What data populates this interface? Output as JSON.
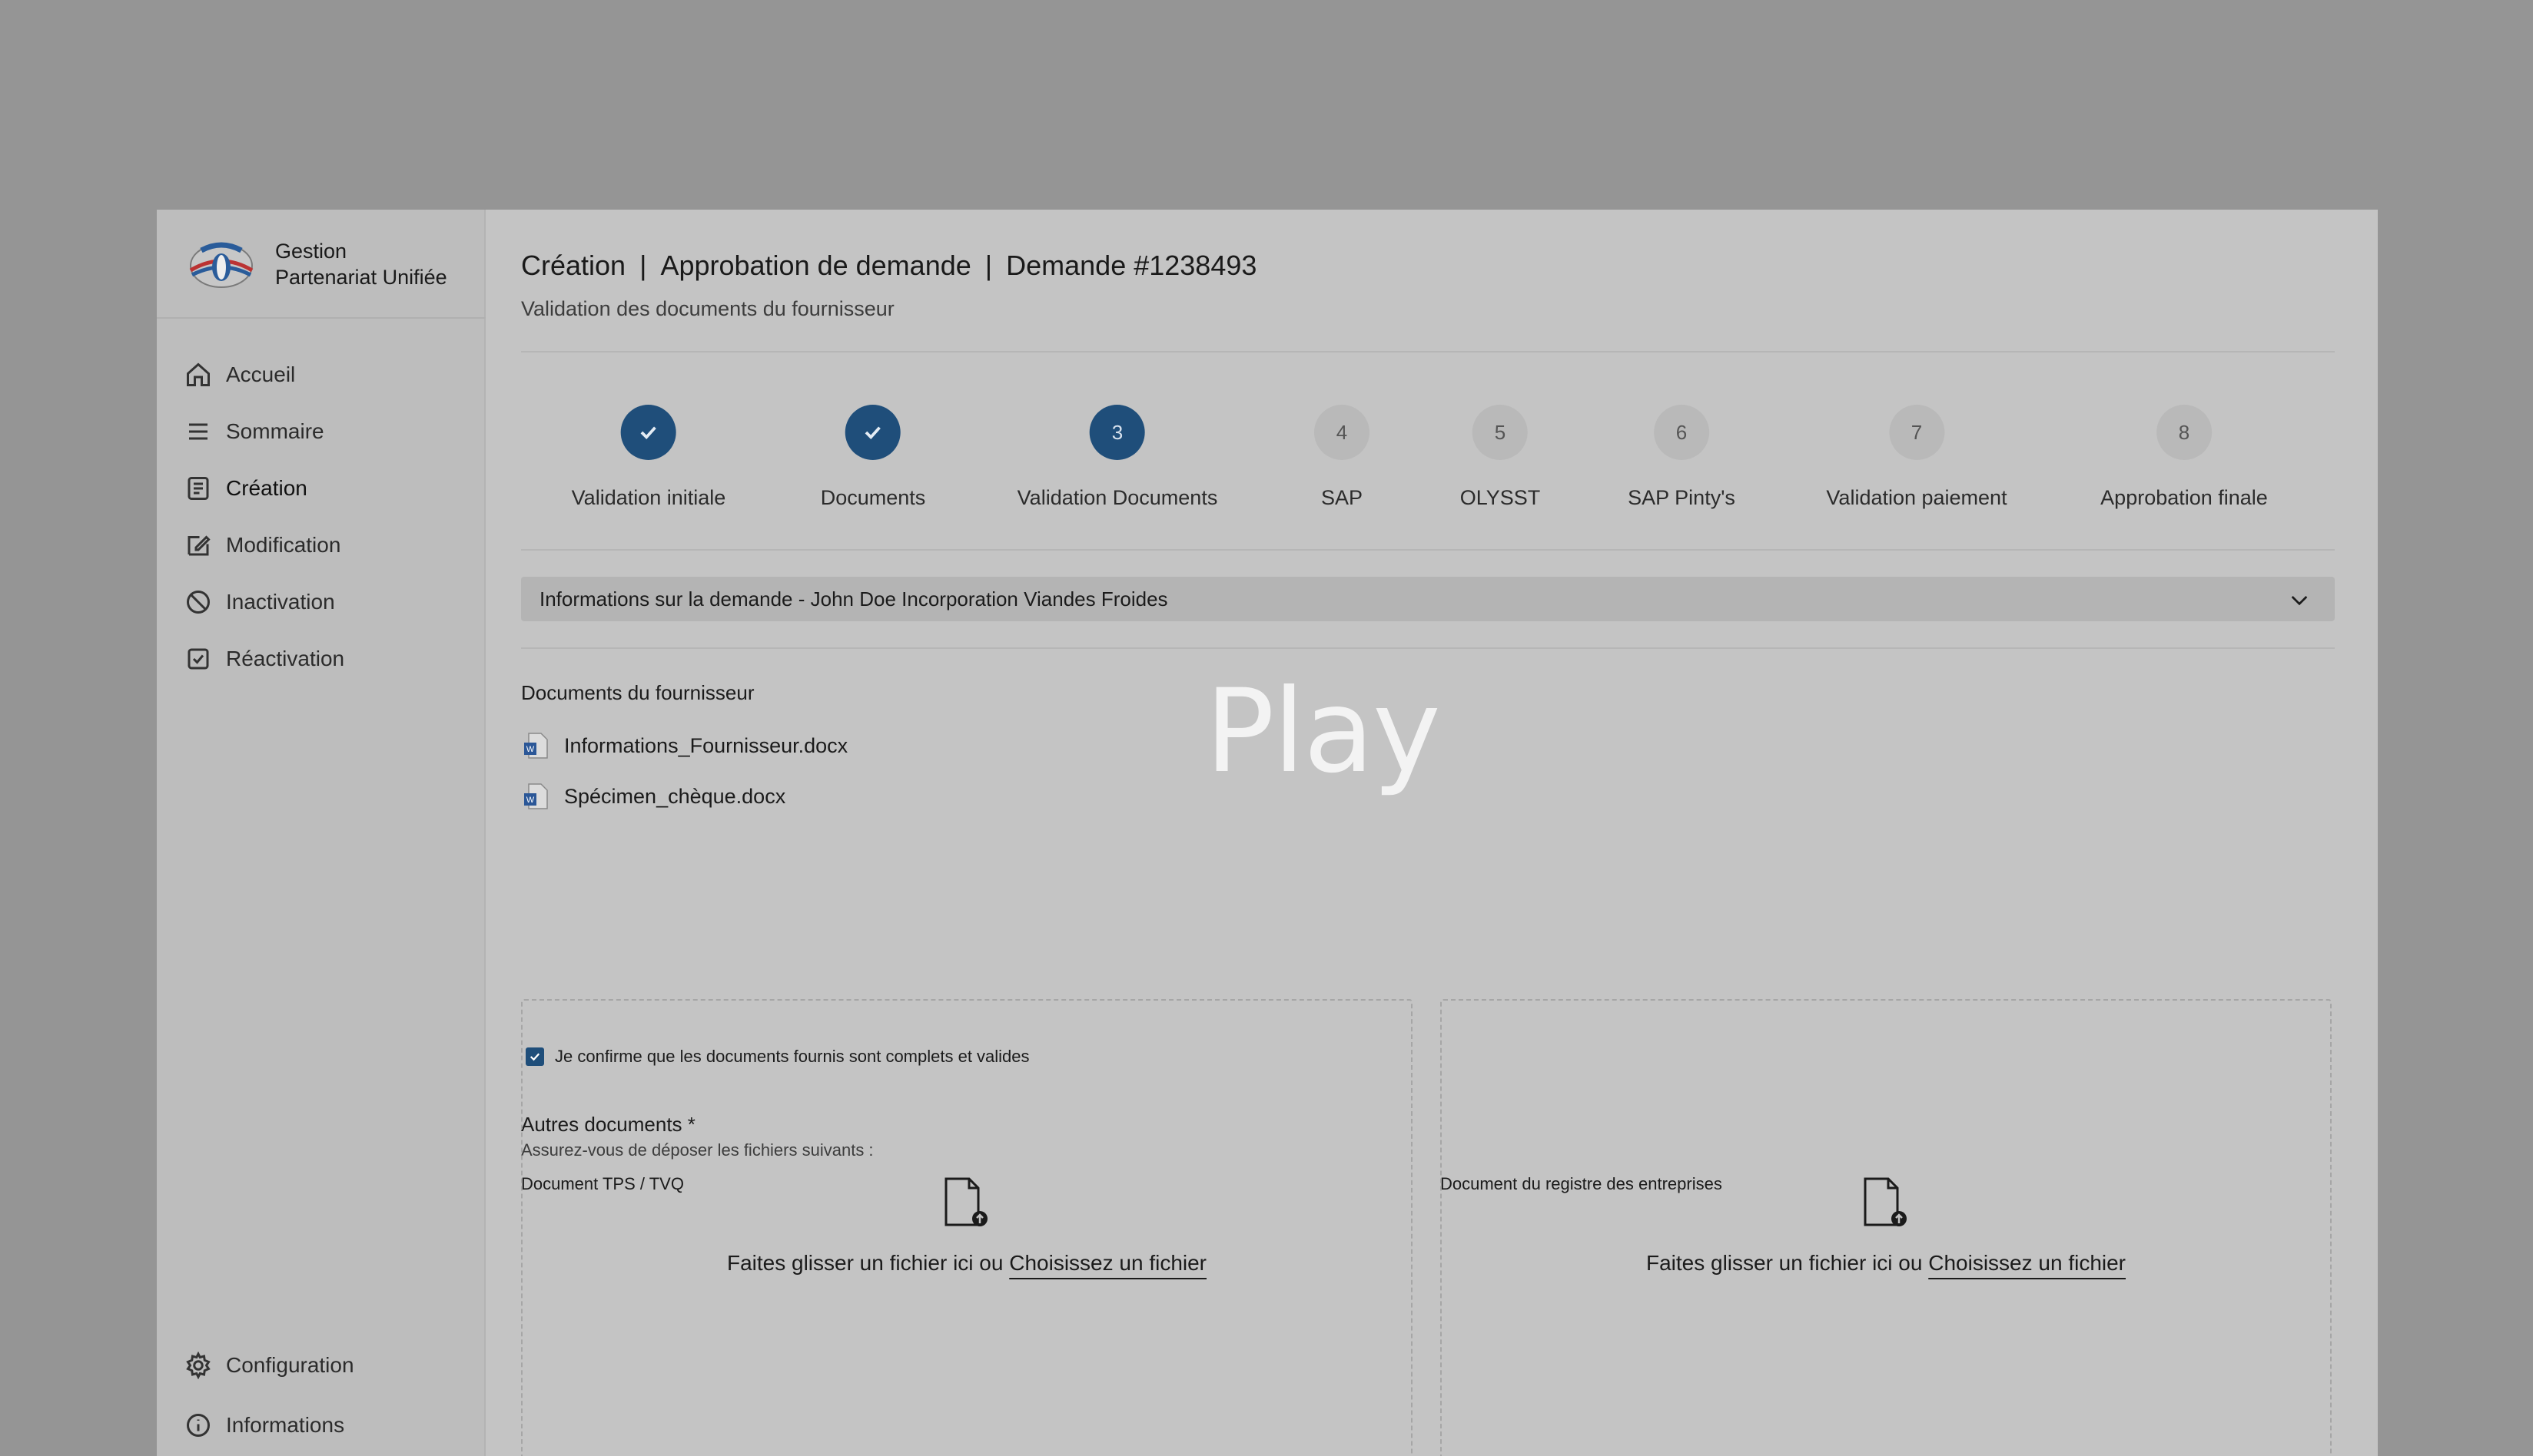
{
  "brand": {
    "line1": "Gestion",
    "line2": "Partenariat Unifiée",
    "logo_icon": "olympic-logo-icon"
  },
  "sidebar": {
    "items": [
      {
        "label": "Accueil",
        "icon": "home-icon"
      },
      {
        "label": "Sommaire",
        "icon": "list-icon"
      },
      {
        "label": "Création",
        "icon": "document-icon",
        "active": true
      },
      {
        "label": "Modification",
        "icon": "edit-icon"
      },
      {
        "label": "Inactivation",
        "icon": "ban-icon"
      },
      {
        "label": "Réactivation",
        "icon": "check-square-icon"
      }
    ],
    "bottom": [
      {
        "label": "Configuration",
        "icon": "gear-icon"
      },
      {
        "label": "Informations",
        "icon": "info-icon"
      }
    ]
  },
  "header": {
    "part1": "Création",
    "sep1": "|",
    "part2": "Approbation de demande",
    "sep2": "|",
    "part3": "Demande #1238493",
    "subtitle": "Validation des documents du fournisseur"
  },
  "steps": [
    {
      "number": "1",
      "label": "Validation initiale",
      "state": "done"
    },
    {
      "number": "2",
      "label": "Documents",
      "state": "done"
    },
    {
      "number": "3",
      "label": "Validation Documents",
      "state": "current"
    },
    {
      "number": "4",
      "label": "SAP",
      "state": "pending"
    },
    {
      "number": "5",
      "label": "OLYSST",
      "state": "pending"
    },
    {
      "number": "6",
      "label": "SAP Pinty's",
      "state": "pending"
    },
    {
      "number": "7",
      "label": "Validation paiement",
      "state": "pending"
    },
    {
      "number": "8",
      "label": "Approbation finale",
      "state": "pending"
    }
  ],
  "accordion": {
    "label": "Informations sur la demande - John Doe Incorporation Viandes Froides"
  },
  "supplier_docs": {
    "title": "Documents du fournisseur",
    "files": [
      "Informations_Fournisseur.docx",
      "Spécimen_chèque.docx"
    ],
    "confirm_label": "Je confirme que les documents fournis sont complets et valides",
    "confirm_checked": true
  },
  "other_docs": {
    "title": "Autres documents *",
    "hint": "Assurez-vous de déposer les fichiers suivants :",
    "zones": [
      {
        "label": "Document TPS / TVQ",
        "drop_text": "Faites glisser un fichier ici ou",
        "link": "Choisissez un fichier"
      },
      {
        "label": "Document du registre des entreprises",
        "drop_text": "Faites glisser un fichier ici ou",
        "link": "Choisissez un fichier"
      }
    ]
  },
  "overlay": {
    "label": "Play"
  },
  "colors": {
    "accent": "#1f4e7a",
    "background": "#c4c4c4",
    "sidebar": "#bdbdbd",
    "backdrop": "#959595"
  }
}
